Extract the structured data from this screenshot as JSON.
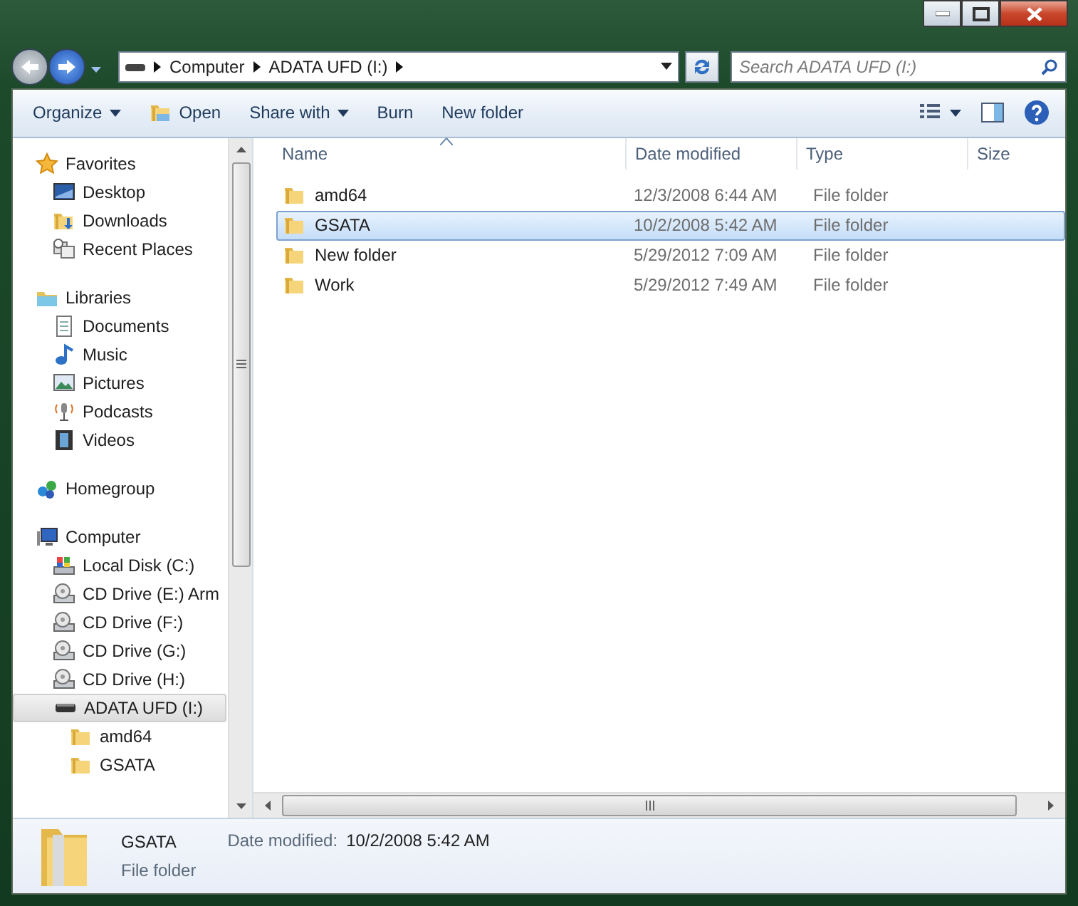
{
  "address_bar": {
    "segments": [
      "Computer",
      "ADATA UFD (I:)"
    ]
  },
  "search": {
    "placeholder": "Search ADATA UFD (I:)"
  },
  "toolbar": [
    {
      "label": "Organize",
      "kind": "menu"
    },
    {
      "label": "Open",
      "kind": "open"
    },
    {
      "label": "Share with",
      "kind": "menu"
    },
    {
      "label": "Burn",
      "kind": "plain"
    },
    {
      "label": "New folder",
      "kind": "plain"
    }
  ],
  "navigation": [
    {
      "label": "Favorites",
      "kind": "star",
      "selected": false,
      "children": [
        {
          "label": "Desktop",
          "kind": "desktop",
          "selected": false
        },
        {
          "label": "Downloads",
          "kind": "downloads",
          "selected": false
        },
        {
          "label": "Recent Places",
          "kind": "recent",
          "selected": false
        }
      ]
    },
    {
      "label": "Libraries",
      "kind": "library",
      "selected": false,
      "children": [
        {
          "label": "Documents",
          "kind": "document",
          "selected": false
        },
        {
          "label": "Music",
          "kind": "music",
          "selected": false
        },
        {
          "label": "Pictures",
          "kind": "picture",
          "selected": false
        },
        {
          "label": "Podcasts",
          "kind": "podcast",
          "selected": false
        },
        {
          "label": "Videos",
          "kind": "video",
          "selected": false
        }
      ]
    },
    {
      "label": "Homegroup",
      "kind": "homegroup",
      "selected": false
    },
    {
      "label": "Computer",
      "kind": "computer",
      "selected": false,
      "children": [
        {
          "label": "Local Disk (C:)",
          "kind": "disk",
          "selected": false
        },
        {
          "label": "CD Drive (E:) Arm",
          "kind": "cd",
          "selected": false
        },
        {
          "label": "CD Drive (F:)",
          "kind": "cd",
          "selected": false
        },
        {
          "label": "CD Drive (G:)",
          "kind": "cd",
          "selected": false
        },
        {
          "label": "CD Drive (H:)",
          "kind": "cd",
          "selected": false
        },
        {
          "label": "ADATA UFD (I:)",
          "kind": "usb",
          "selected": true,
          "children": [
            {
              "label": "amd64",
              "kind": "folder",
              "selected": false
            },
            {
              "label": "GSATA",
              "kind": "folder",
              "selected": false
            }
          ]
        }
      ]
    }
  ],
  "columns": [
    {
      "label": "Name",
      "sorted": true
    },
    {
      "label": "Date modified",
      "sorted": false
    },
    {
      "label": "Type",
      "sorted": false
    },
    {
      "label": "Size",
      "sorted": false
    }
  ],
  "rows": [
    {
      "name": "amd64",
      "date": "12/3/2008 6:44 AM",
      "type": "File folder",
      "selected": false
    },
    {
      "name": "GSATA",
      "date": "10/2/2008 5:42 AM",
      "type": "File folder",
      "selected": true
    },
    {
      "name": "New folder",
      "date": "5/29/2012 7:09 AM",
      "type": "File folder",
      "selected": false
    },
    {
      "name": "Work",
      "date": "5/29/2012 7:49 AM",
      "type": "File folder",
      "selected": false
    }
  ],
  "details": {
    "name": "GSATA",
    "type": "File folder",
    "date_label": "Date modified:",
    "date_value": "10/2/2008 5:42 AM"
  }
}
